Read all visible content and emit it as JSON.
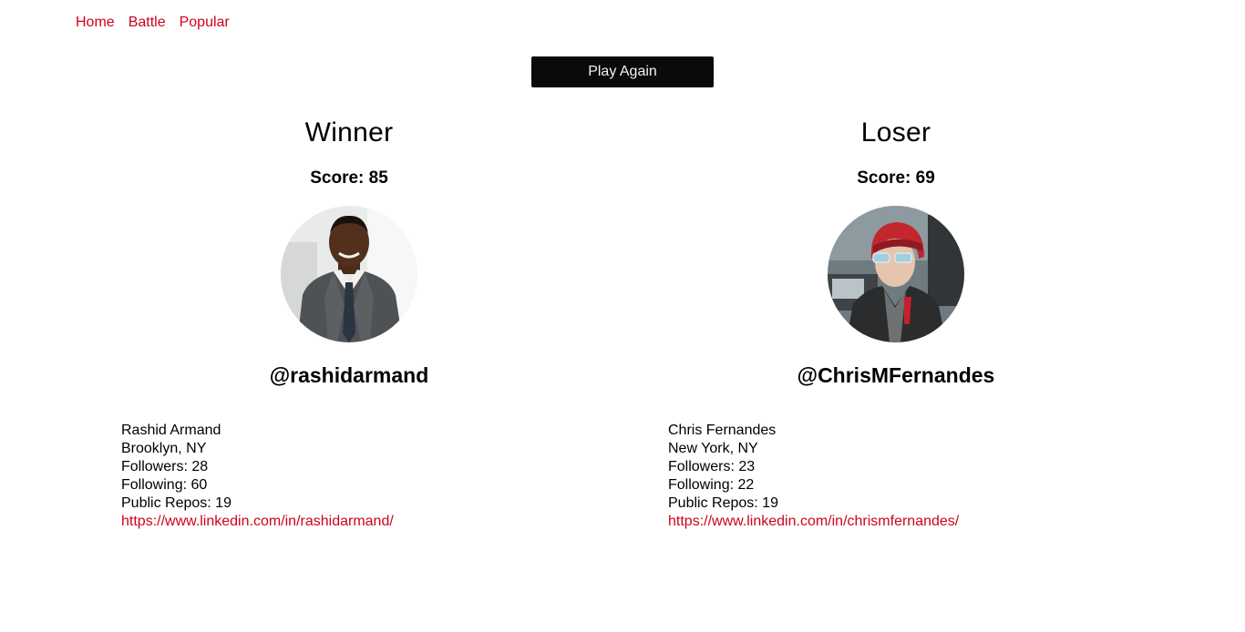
{
  "nav": {
    "items": [
      "Home",
      "Battle",
      "Popular"
    ]
  },
  "play_again_label": "Play Again",
  "colors": {
    "accent": "#d0021b",
    "button_bg": "#0a0a0a"
  },
  "players": [
    {
      "header": "Winner",
      "score": "Score: 85",
      "avatar": "rashidarmand-avatar",
      "username": "@rashidarmand",
      "name": "Rashid Armand",
      "location": "Brooklyn, NY",
      "followers": "Followers: 28",
      "following": "Following: 60",
      "repos": "Public Repos: 19",
      "blog": "https://www.linkedin.com/in/rashidarmand/"
    },
    {
      "header": "Loser",
      "score": "Score: 69",
      "avatar": "chrismfernandes-avatar",
      "username": "@ChrisMFernandes",
      "name": "Chris Fernandes",
      "location": "New York, NY",
      "followers": "Followers: 23",
      "following": "Following: 22",
      "repos": "Public Repos: 19",
      "blog": "https://www.linkedin.com/in/chrismfernandes/"
    }
  ]
}
